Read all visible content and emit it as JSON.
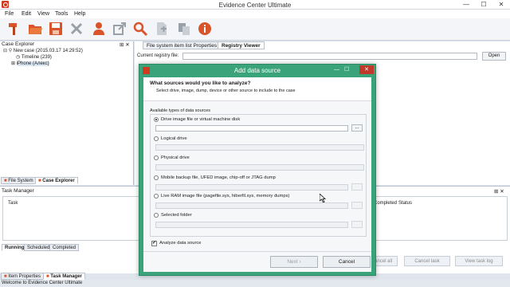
{
  "window": {
    "title": "Evidence Center Ultimate",
    "minimize": "—",
    "maximize": "☐",
    "close": "✕"
  },
  "menu": [
    "File",
    "Edit",
    "View",
    "Tools",
    "Help"
  ],
  "toolbar": {
    "icons": [
      "hammer-icon",
      "folder-open-icon",
      "save-icon",
      "delete-icon",
      "user-icon",
      "export-icon",
      "search-icon",
      "document-add-icon",
      "copy-icon",
      "info-icon"
    ]
  },
  "case_explorer": {
    "title": "Case Explorer",
    "pin": "⊞ ✕",
    "tree": [
      "New case (2015.03.17 14:29:52)",
      "Timeline (239)",
      "iPhone (Алекс)"
    ],
    "tabs": [
      "File System",
      "Case Explorer"
    ]
  },
  "right_tabs": [
    "File system item list Properties",
    "Registry Viewer"
  ],
  "registry": {
    "current_file_label": "Current registry file:",
    "open_button": "Open"
  },
  "task_manager": {
    "title": "Task Manager",
    "col_task": "Task",
    "col_completed": "Completed",
    "col_status": "Status",
    "tabs": [
      "Running",
      "Scheduled",
      "Completed"
    ],
    "buttons": [
      "Cancel all",
      "Cancel task",
      "View task log"
    ]
  },
  "bottom_tabs": [
    "Item Properties",
    "Task Manager"
  ],
  "status": "Welcome to Evidence Center Ultimate",
  "dialog": {
    "title": "Add data source",
    "heading": "What sources would you like to analyze?",
    "subheading": "Select drive, image, dump, device or other source to include to the case",
    "group_label": "Available types of data sources",
    "options": [
      "Drive image file or virtual machine disk",
      "Logical drive",
      "Physical drive",
      "Mobile backup file, UFED image, chip-off or JTAG dump",
      "Live RAM image file (pagefile.sys, hiberfil.sys, memory dumps)",
      "Selected folder"
    ],
    "browse": "...",
    "checkbox_label": "Analyze data source",
    "next_button": "Next ›",
    "cancel_button": "Cancel"
  },
  "colors": {
    "dialog_frame": "#3aa37a",
    "brand_red": "#d13a1f"
  }
}
